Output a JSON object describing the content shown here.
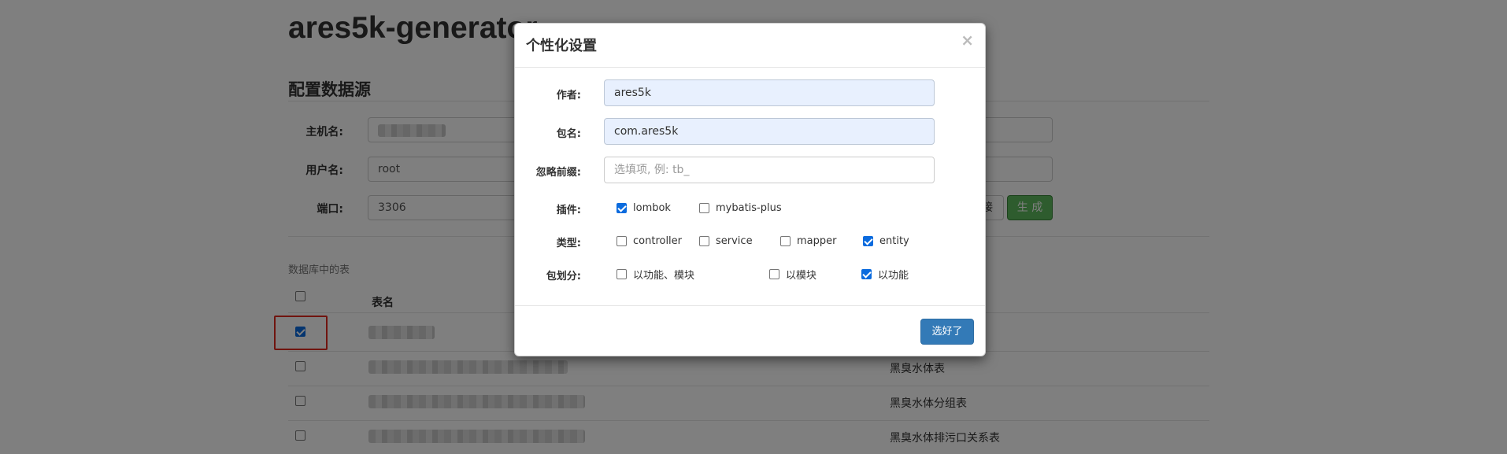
{
  "page": {
    "title": "ares5k-generator",
    "section_title": "配置数据源",
    "form": {
      "host_label": "主机名:",
      "user_label": "用户名:",
      "user_value": "root",
      "port_label": "端口:",
      "port_value": "3306",
      "connect_label": "接",
      "generate_label": "生 成"
    },
    "tables": {
      "caption": "数据库中的表",
      "col_name": "表名",
      "rows": [
        {
          "checked": true,
          "comment": ""
        },
        {
          "checked": false,
          "comment": "黑臭水体表"
        },
        {
          "checked": false,
          "comment": "黑臭水体分组表"
        },
        {
          "checked": false,
          "comment": "黑臭水体排污口关系表"
        }
      ]
    }
  },
  "modal": {
    "title": "个性化设置",
    "close_glyph": "×",
    "author_label": "作者:",
    "author_value": "ares5k",
    "package_label": "包名:",
    "package_value": "com.ares5k",
    "prefix_label": "忽略前缀:",
    "prefix_placeholder": "选填项, 例: tb_",
    "plugin_label": "插件:",
    "plugins": [
      {
        "label": "lombok",
        "checked": true
      },
      {
        "label": "mybatis-plus",
        "checked": false
      }
    ],
    "type_label": "类型:",
    "types": [
      {
        "label": "controller",
        "checked": false
      },
      {
        "label": "service",
        "checked": false
      },
      {
        "label": "mapper",
        "checked": false
      },
      {
        "label": "entity",
        "checked": true
      }
    ],
    "division_label": "包划分:",
    "divisions": [
      {
        "label": "以功能、模块",
        "checked": false
      },
      {
        "label": "以模块",
        "checked": false
      },
      {
        "label": "以功能",
        "checked": true
      }
    ],
    "ok_label": "选好了"
  },
  "colors": {
    "primary": "#337ab7",
    "success": "#5cb85c",
    "checkbox": "#0b6bde",
    "highlight": "#e0291f"
  }
}
